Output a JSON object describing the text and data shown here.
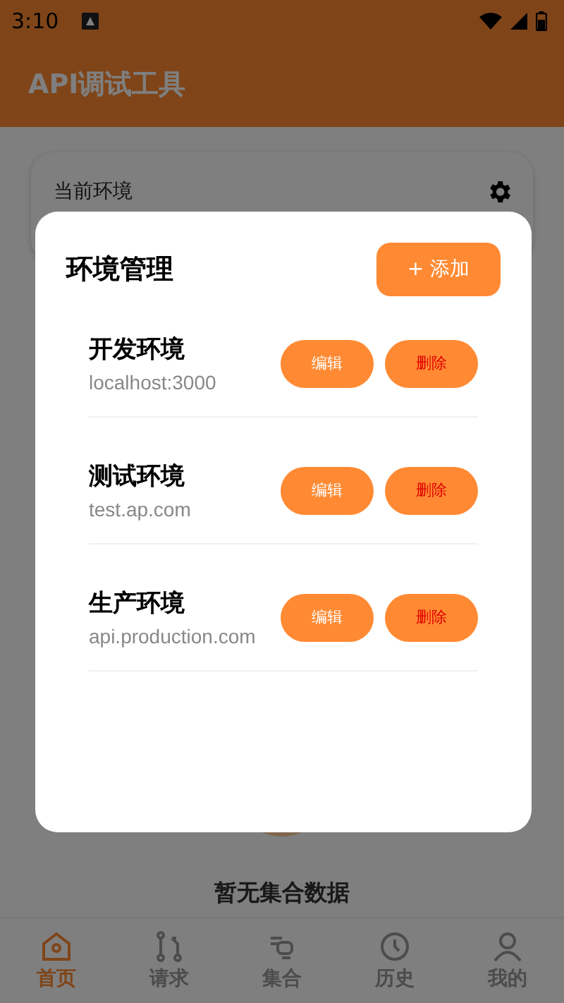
{
  "status_bar": {
    "time": "3:10"
  },
  "app_bar": {
    "title": "API调试工具"
  },
  "current_env": {
    "label": "当前环境"
  },
  "empty_state": {
    "text": "暂无集合数据"
  },
  "bottom_nav": [
    {
      "label": "首页",
      "selected": true
    },
    {
      "label": "请求",
      "selected": false
    },
    {
      "label": "集合",
      "selected": false
    },
    {
      "label": "历史",
      "selected": false
    },
    {
      "label": "我的",
      "selected": false
    }
  ],
  "dialog": {
    "title": "环境管理",
    "add_button": "+ 添加",
    "environments": [
      {
        "name": "开发环境",
        "url": "localhost:3000",
        "edit_label": "编辑",
        "delete_label": "删除"
      },
      {
        "name": "测试环境",
        "url": "test.ap.com",
        "edit_label": "编辑",
        "delete_label": "删除"
      },
      {
        "name": "生产环境",
        "url": "api.production.com",
        "edit_label": "编辑",
        "delete_label": "删除"
      }
    ]
  }
}
